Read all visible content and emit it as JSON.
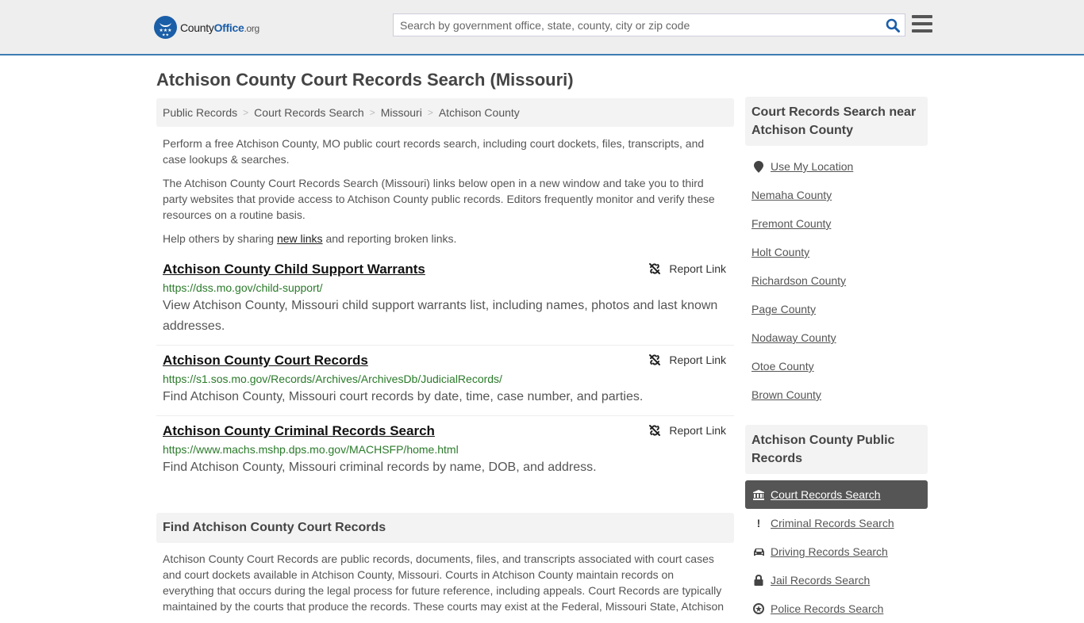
{
  "header": {
    "logo": {
      "text_part1": "County",
      "text_part2": "Office",
      "text_part3": ".org"
    },
    "search": {
      "placeholder": "Search by government office, state, county, city or zip code",
      "value": ""
    },
    "colors": {
      "brand": "#1a5ea8",
      "accent_border": "#3e7cb1"
    }
  },
  "page": {
    "title": "Atchison County Court Records Search (Missouri)"
  },
  "breadcrumb": [
    {
      "label": "Public Records"
    },
    {
      "label": "Court Records Search"
    },
    {
      "label": "Missouri"
    },
    {
      "label": "Atchison County"
    }
  ],
  "intro": {
    "p1": "Perform a free Atchison County, MO public court records search, including court dockets, files, transcripts, and case lookups & searches.",
    "p2": "The Atchison County Court Records Search (Missouri) links below open in a new window and take you to third party websites that provide access to Atchison County public records. Editors frequently monitor and verify these resources on a routine basis.",
    "p3_before": "Help others by sharing ",
    "p3_link": "new links",
    "p3_after": " and reporting broken links."
  },
  "results": [
    {
      "title": "Atchison County Child Support Warrants",
      "url": "https://dss.mo.gov/child-support/",
      "description": "View Atchison County, Missouri child support warrants list, including names, photos and last known addresses.",
      "report_label": "Report Link"
    },
    {
      "title": "Atchison County Court Records",
      "url": "https://s1.sos.mo.gov/Records/Archives/ArchivesDb/JudicialRecords/",
      "description": "Find Atchison County, Missouri court records by date, time, case number, and parties.",
      "report_label": "Report Link"
    },
    {
      "title": "Atchison County Criminal Records Search",
      "url": "https://www.machs.mshp.dps.mo.gov/MACHSFP/home.html",
      "description": "Find Atchison County, Missouri criminal records by name, DOB, and address.",
      "report_label": "Report Link"
    }
  ],
  "find_section": {
    "heading": "Find Atchison County Court Records",
    "text": "Atchison County Court Records are public records, documents, files, and transcripts associated with court cases and court dockets available in Atchison County, Missouri. Courts in Atchison County maintain records on everything that occurs during the legal process for future reference, including appeals. Court Records are typically maintained by the courts that produce the records. These courts may exist at the Federal, Missouri State, Atchison"
  },
  "sidebar": {
    "nearby_heading": "Court Records Search near Atchison County",
    "use_location": "Use My Location",
    "nearby": [
      "Nemaha County",
      "Fremont County",
      "Holt County",
      "Richardson County",
      "Page County",
      "Nodaway County",
      "Otoe County",
      "Brown County"
    ],
    "records_heading": "Atchison County Public Records",
    "records_nav": [
      {
        "label": "Court Records Search",
        "icon": "courthouse-icon",
        "active": true
      },
      {
        "label": "Criminal Records Search",
        "icon": "exclamation-icon",
        "active": false
      },
      {
        "label": "Driving Records Search",
        "icon": "car-icon",
        "active": false
      },
      {
        "label": "Jail Records Search",
        "icon": "lock-icon",
        "active": false
      },
      {
        "label": "Police Records Search",
        "icon": "police-badge-icon",
        "active": false
      }
    ]
  }
}
